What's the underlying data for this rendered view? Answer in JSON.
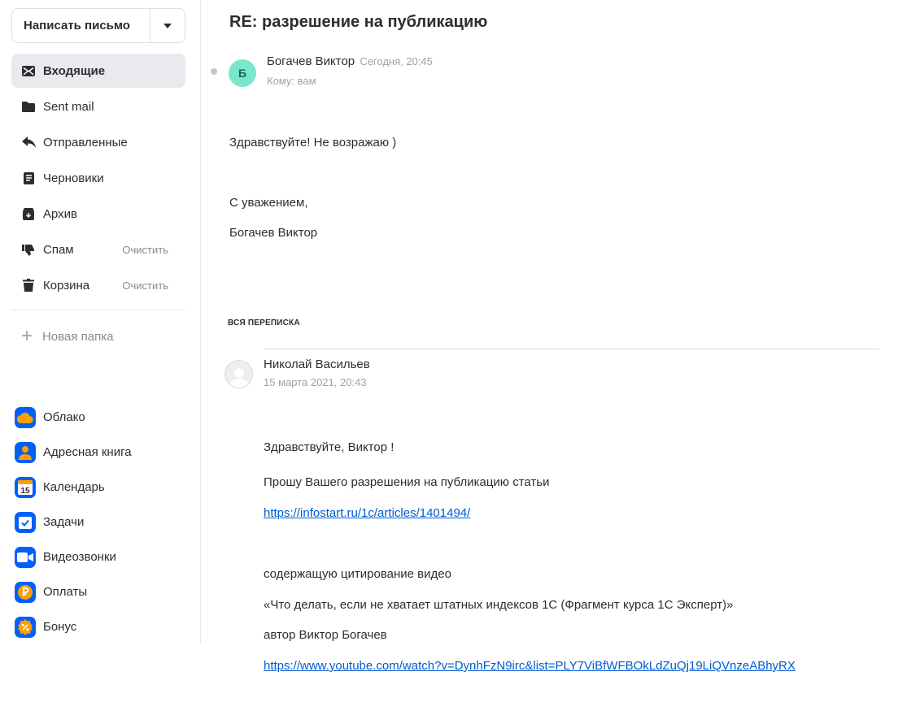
{
  "compose": {
    "label": "Написать письмо"
  },
  "folders": [
    {
      "icon": "envelope-icon",
      "label": "Входящие",
      "active": true
    },
    {
      "icon": "folder-icon",
      "label": "Sent mail"
    },
    {
      "icon": "reply-icon",
      "label": "Отправленные"
    },
    {
      "icon": "draft-icon",
      "label": "Черновики"
    },
    {
      "icon": "archive-icon",
      "label": "Архив"
    },
    {
      "icon": "thumbs-down-icon",
      "label": "Спам",
      "action": "Очистить"
    },
    {
      "icon": "trash-icon",
      "label": "Корзина",
      "action": "Очистить"
    }
  ],
  "new_folder": {
    "label": "Новая папка"
  },
  "services": [
    {
      "icon": "cloud-icon",
      "label": "Облако"
    },
    {
      "icon": "address-book-icon",
      "label": "Адресная книга"
    },
    {
      "icon": "calendar-icon",
      "label": "Календарь",
      "icon_text": "15"
    },
    {
      "icon": "tasks-icon",
      "label": "Задачи"
    },
    {
      "icon": "video-call-icon",
      "label": "Видеозвонки"
    },
    {
      "icon": "payments-icon",
      "label": "Оплаты"
    },
    {
      "icon": "bonus-icon",
      "label": "Бонус"
    }
  ],
  "message": {
    "subject": "RE: разрешение на публикацию",
    "sender_initial": "Б",
    "sender": "Богачев Виктор",
    "date": "Сегодня, 20:45",
    "recipient": "Кому: вам",
    "body": [
      "Здравствуйте! Не возражаю )",
      "С уважением,",
      "Богачев Виктор"
    ]
  },
  "thread": {
    "title": "ВСЯ ПЕРЕПИСКА",
    "sender": "Николай Васильев",
    "date": "15 марта 2021, 20:43",
    "greeting": "Здравствуйте, Виктор !",
    "request": "Прошу Вашего разрешения на публикацию статьи",
    "link1": "https://infostart.ru/1c/articles/1401494/",
    "line_citing": "содержащую цитирование видео",
    "line_title": "«Что делать, если не хватает штатных индексов 1С (Фрагмент курса 1С Эксперт)»",
    "line_author": "автор Виктор Богачев",
    "link2": "https://www.youtube.com/watch?v=DynhFzN9irc&list=PLY7ViBfWFBOkLdZuQj19LiQVnzeABhyRX"
  },
  "colors": {
    "accent": "#005ff9",
    "link": "#005bd1",
    "active_bg": "#e9eaed",
    "avatar": "#7ce5cd"
  }
}
